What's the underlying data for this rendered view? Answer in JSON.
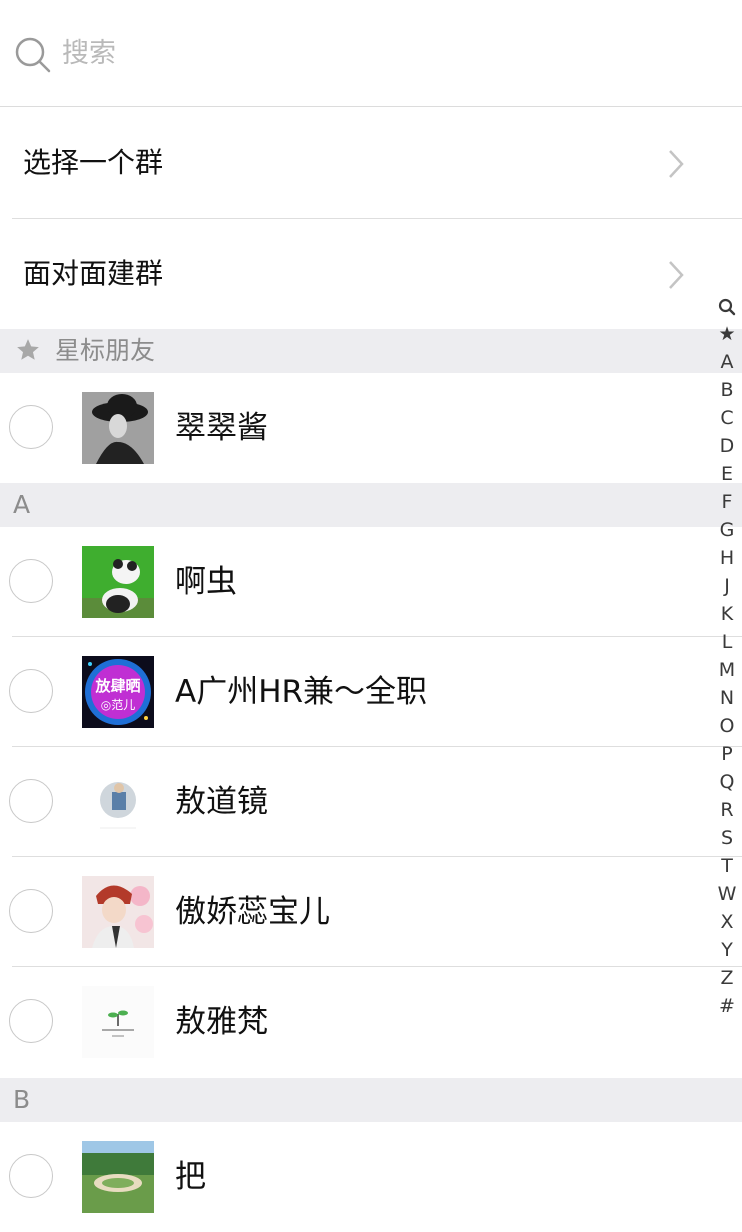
{
  "search": {
    "placeholder": "搜索",
    "value": ""
  },
  "menu": {
    "select_group": "选择一个群",
    "face_to_face": "面对面建群"
  },
  "sections": {
    "starred": "星标朋友",
    "a": "A",
    "b": "B"
  },
  "contacts": [
    {
      "name": "翠翠酱"
    },
    {
      "name": "啊虫"
    },
    {
      "name": "A广州HR兼～全职"
    },
    {
      "name": "敖道镜"
    },
    {
      "name": "傲娇蕊宝儿"
    },
    {
      "name": "敖雅梵"
    },
    {
      "name": "把"
    }
  ],
  "avatars": {
    "promo_line1": "放肆晒",
    "promo_line2": "◎范儿"
  },
  "index": [
    "★",
    "A",
    "B",
    "C",
    "D",
    "E",
    "F",
    "G",
    "H",
    "J",
    "K",
    "L",
    "M",
    "N",
    "O",
    "P",
    "Q",
    "R",
    "S",
    "T",
    "W",
    "X",
    "Y",
    "Z",
    "#"
  ],
  "colors": {
    "section_bg": "#ededf0",
    "divider": "#dedede",
    "placeholder": "#b9b9b9"
  }
}
